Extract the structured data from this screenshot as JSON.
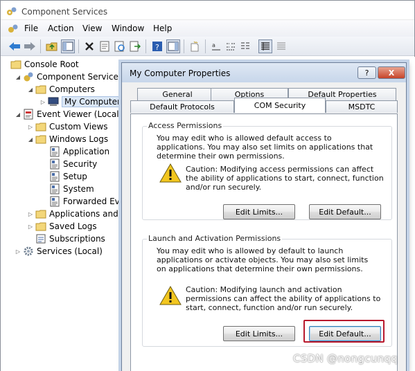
{
  "window": {
    "title": "Component Services"
  },
  "menu": [
    "File",
    "Action",
    "View",
    "Window",
    "Help"
  ],
  "tree": {
    "items": [
      {
        "label": "Console Root",
        "icon": "folder-icon"
      },
      {
        "label": "Component Services",
        "icon": "component-services-icon"
      },
      {
        "label": "Computers",
        "icon": "folder-icon"
      },
      {
        "label": "My Computer",
        "icon": "computer-icon"
      },
      {
        "label": "Event Viewer (Local)",
        "icon": "event-viewer-icon"
      },
      {
        "label": "Custom Views",
        "icon": "folder-icon"
      },
      {
        "label": "Windows Logs",
        "icon": "folder-icon"
      },
      {
        "label": "Application",
        "icon": "log-icon"
      },
      {
        "label": "Security",
        "icon": "log-icon"
      },
      {
        "label": "Setup",
        "icon": "log-icon"
      },
      {
        "label": "System",
        "icon": "log-icon"
      },
      {
        "label": "Forwarded Even",
        "icon": "log-icon"
      },
      {
        "label": "Applications and Se",
        "icon": "folder-icon"
      },
      {
        "label": "Saved Logs",
        "icon": "folder-icon"
      },
      {
        "label": "Subscriptions",
        "icon": "subscriptions-icon"
      },
      {
        "label": "Services (Local)",
        "icon": "gear-icon"
      }
    ]
  },
  "dialog": {
    "title": "My Computer Properties",
    "help": "?",
    "close": "X",
    "tabs_top": [
      "General",
      "Options",
      "Default Properties"
    ],
    "tabs_bottom": [
      "Default Protocols",
      "COM Security",
      "MSDTC"
    ],
    "access": {
      "title": "Access Permissions",
      "desc": "You may edit who is allowed default access to applications. You may also set limits on applications that determine their own permissions.",
      "caution": "Caution: Modifying access permissions can affect the ability of applications to start, connect, function and/or run securely.",
      "edit_limits": "Edit Limits...",
      "edit_default": "Edit Default..."
    },
    "launch": {
      "title": "Launch and Activation Permissions",
      "desc": "You may edit who is allowed by default to launch applications or activate objects. You may also set limits on applications that determine their own permissions.",
      "caution": "Caution: Modifying launch and activation permissions can affect the ability of applications to start, connect, function and/or run securely.",
      "edit_limits": "Edit Limits...",
      "edit_default": "Edit Default..."
    }
  },
  "watermark": "CSDN @nongcunqq",
  "colors": {
    "highlight": "#b8182c",
    "title_bar": "#c7d6ea",
    "close": "#c64429"
  }
}
